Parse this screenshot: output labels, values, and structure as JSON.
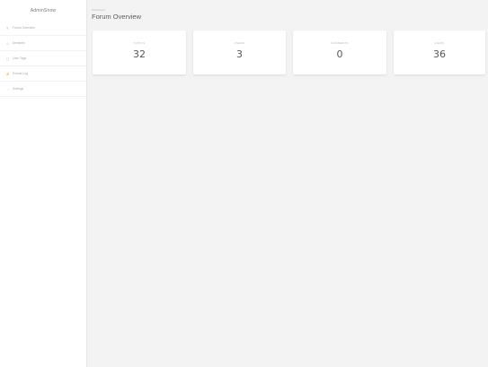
{
  "sidebar": {
    "brand": "AdminSnow",
    "items": [
      {
        "icon": "chat-icon",
        "glyph": "✎",
        "label": "Forum Overview"
      },
      {
        "icon": "users-icon",
        "glyph": "☺",
        "label": "Members"
      },
      {
        "icon": "tag-icon",
        "glyph": "▢",
        "label": "User Tags"
      },
      {
        "icon": "bolt-icon",
        "glyph": "⚡",
        "label": "Events Log"
      },
      {
        "icon": "settings-icon",
        "glyph": "◦",
        "label": "Settings"
      }
    ]
  },
  "header": {
    "breadcrumb": "Dashboard",
    "title": "Forum Overview"
  },
  "cards": [
    {
      "label": "TOPICS",
      "value": "32"
    },
    {
      "label": "USERS",
      "value": "3"
    },
    {
      "label": "COMMENTS",
      "value": "0"
    },
    {
      "label": "VIEWS",
      "value": "36"
    }
  ]
}
